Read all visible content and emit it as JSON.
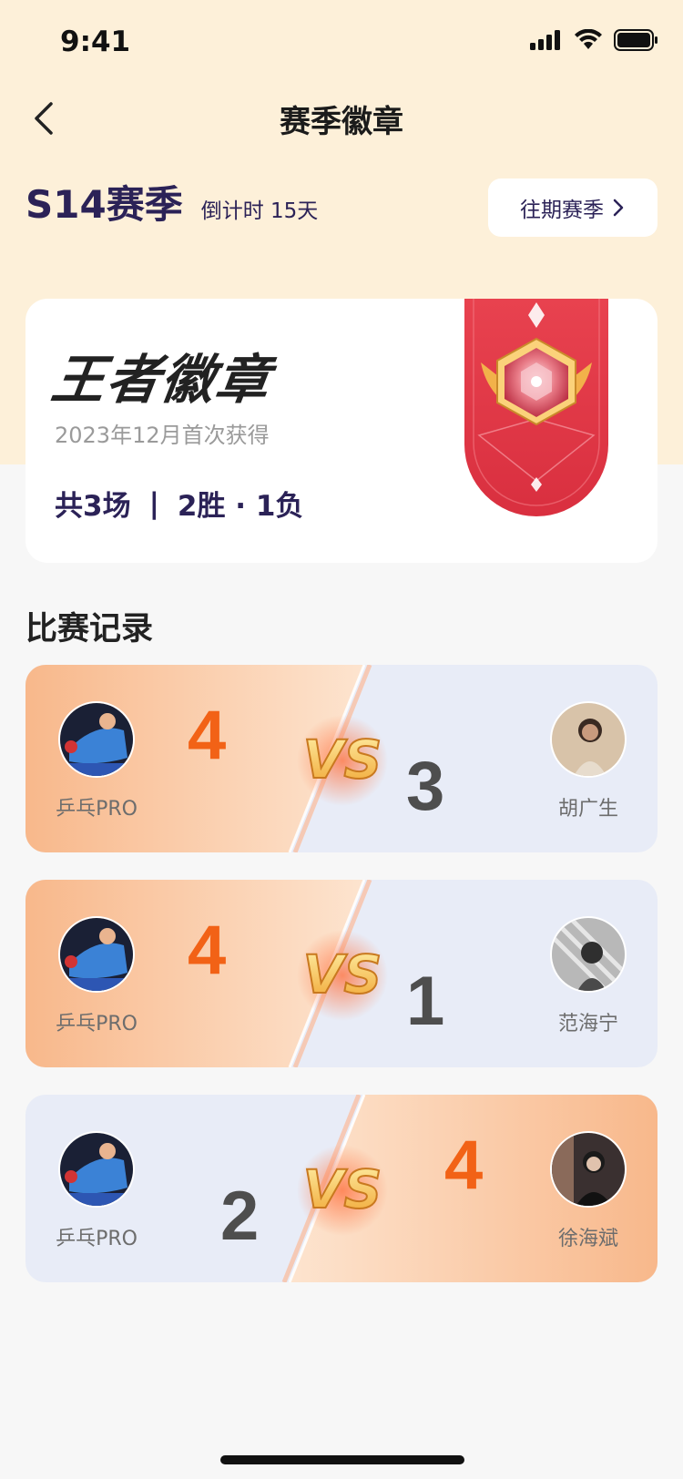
{
  "status_bar": {
    "time": "9:41"
  },
  "nav": {
    "title": "赛季徽章"
  },
  "season": {
    "name": "S14赛季",
    "countdown": "倒计时 15天",
    "past_button": "往期赛季"
  },
  "badge": {
    "title": "王者徽章",
    "date": "2023年12月首次获得",
    "total": "共3场",
    "separator": "|",
    "record": "2胜 · 1负"
  },
  "section": {
    "title": "比赛记录"
  },
  "matches": [
    {
      "left_name": "乒乓PRO",
      "left_score": "4",
      "right_name": "胡广生",
      "right_score": "3",
      "winner": "left"
    },
    {
      "left_name": "乒乓PRO",
      "left_score": "4",
      "right_name": "范海宁",
      "right_score": "1",
      "winner": "left"
    },
    {
      "left_name": "乒乓PRO",
      "left_score": "2",
      "right_name": "徐海斌",
      "right_score": "4",
      "winner": "right"
    }
  ],
  "vs_label": "VS",
  "colors": {
    "accent": "#f26216",
    "navy": "#2b2257",
    "badge_red": "#e23a48",
    "win_bg": "#f8b88b",
    "lose_bg": "#e8ecf7"
  }
}
